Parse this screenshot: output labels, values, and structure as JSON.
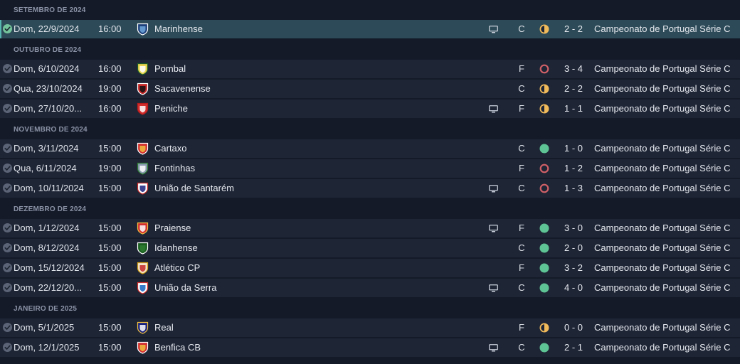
{
  "colors": {
    "win": "#5ec495",
    "draw": "#f0b95a",
    "loss": "#d06067",
    "row_bg": "#1e2535",
    "selected_row_bg": "#2c4a57",
    "page_bg": "#141a28"
  },
  "groups": [
    {
      "month": "SETEMBRO DE 2024",
      "matches": [
        {
          "date": "Dom, 22/9/2024",
          "time": "16:00",
          "team": "Marinhense",
          "crest": "marinhense-crest",
          "tv": true,
          "venue": "C",
          "result": "draw",
          "score": "2 - 2",
          "competition": "Campeonato de Portugal Série C",
          "selected": true
        }
      ]
    },
    {
      "month": "OUTUBRO DE 2024",
      "matches": [
        {
          "date": "Dom, 6/10/2024",
          "time": "16:00",
          "team": "Pombal",
          "crest": "pombal-crest",
          "tv": false,
          "venue": "F",
          "result": "loss",
          "score": "3 - 4",
          "competition": "Campeonato de Portugal Série C"
        },
        {
          "date": "Qua, 23/10/2024",
          "time": "19:00",
          "team": "Sacavenense",
          "crest": "sacavenense-crest",
          "tv": false,
          "venue": "C",
          "result": "draw",
          "score": "2 - 2",
          "competition": "Campeonato de Portugal Série C"
        },
        {
          "date": "Dom, 27/10/20...",
          "time": "16:00",
          "team": "Peniche",
          "crest": "peniche-crest",
          "tv": true,
          "venue": "F",
          "result": "draw",
          "score": "1 - 1",
          "competition": "Campeonato de Portugal Série C"
        }
      ]
    },
    {
      "month": "NOVEMBRO DE 2024",
      "matches": [
        {
          "date": "Dom, 3/11/2024",
          "time": "15:00",
          "team": "Cartaxo",
          "crest": "cartaxo-crest",
          "tv": false,
          "venue": "C",
          "result": "win",
          "score": "1 - 0",
          "competition": "Campeonato de Portugal Série C"
        },
        {
          "date": "Qua, 6/11/2024",
          "time": "19:00",
          "team": "Fontinhas",
          "crest": "fontinhas-crest",
          "tv": false,
          "venue": "F",
          "result": "loss",
          "score": "1 - 2",
          "competition": "Campeonato de Portugal Série C"
        },
        {
          "date": "Dom, 10/11/2024",
          "time": "15:00",
          "team": "União de Santarém",
          "crest": "uniao-santarem-crest",
          "tv": true,
          "venue": "C",
          "result": "loss",
          "score": "1 - 3",
          "competition": "Campeonato de Portugal Série C"
        }
      ]
    },
    {
      "month": "DEZEMBRO DE 2024",
      "matches": [
        {
          "date": "Dom, 1/12/2024",
          "time": "15:00",
          "team": "Praiense",
          "crest": "praiense-crest",
          "tv": true,
          "venue": "F",
          "result": "win",
          "score": "3 - 0",
          "competition": "Campeonato de Portugal Série C"
        },
        {
          "date": "Dom, 8/12/2024",
          "time": "15:00",
          "team": "Idanhense",
          "crest": "idanhense-crest",
          "tv": false,
          "venue": "C",
          "result": "win",
          "score": "2 - 0",
          "competition": "Campeonato de Portugal Série C"
        },
        {
          "date": "Dom, 15/12/2024",
          "time": "15:00",
          "team": "Atlético CP",
          "crest": "atletico-cp-crest",
          "tv": false,
          "venue": "F",
          "result": "win",
          "score": "3 - 2",
          "competition": "Campeonato de Portugal Série C"
        },
        {
          "date": "Dom, 22/12/20...",
          "time": "15:00",
          "team": "União da Serra",
          "crest": "uniao-serra-crest",
          "tv": true,
          "venue": "C",
          "result": "win",
          "score": "4 - 0",
          "competition": "Campeonato de Portugal Série C"
        }
      ]
    },
    {
      "month": "JANEIRO DE 2025",
      "matches": [
        {
          "date": "Dom, 5/1/2025",
          "time": "15:00",
          "team": "Real",
          "crest": "real-crest",
          "tv": false,
          "venue": "F",
          "result": "draw",
          "score": "0 - 0",
          "competition": "Campeonato de Portugal Série C"
        },
        {
          "date": "Dom, 12/1/2025",
          "time": "15:00",
          "team": "Benfica CB",
          "crest": "benfica-cb-crest",
          "tv": true,
          "venue": "C",
          "result": "win",
          "score": "2 - 1",
          "competition": "Campeonato de Portugal Série C"
        }
      ]
    }
  ]
}
